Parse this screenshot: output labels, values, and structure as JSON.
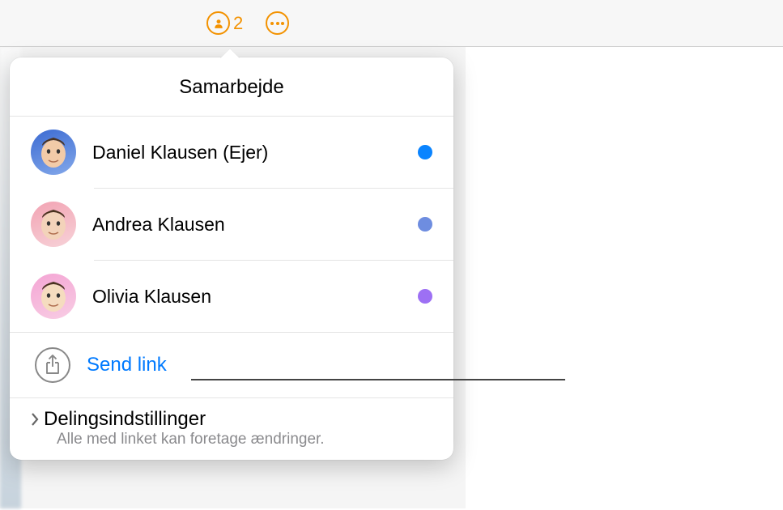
{
  "toolbar": {
    "collab_count": "2"
  },
  "popover": {
    "title": "Samarbejde",
    "participants": [
      {
        "name": "Daniel Klausen (Ejer)",
        "status_color": "#0a84ff",
        "avatar_bg": "linear-gradient(160deg,#3c6bd2,#83a8ea)",
        "face": "#f2cba8"
      },
      {
        "name": "Andrea Klausen",
        "status_color": "#6e8de0",
        "avatar_bg": "linear-gradient(160deg,#f2a3b3,#f7d2d8)",
        "face": "#f3d3ba"
      },
      {
        "name": "Olivia Klausen",
        "status_color": "#9d70f4",
        "avatar_bg": "linear-gradient(160deg,#f4a5d4,#f8cde4)",
        "face": "#f5dcbf"
      }
    ],
    "send_link_label": "Send link",
    "settings": {
      "title": "Delingsindstillinger",
      "subtitle": "Alle med linket kan foretage ændringer."
    }
  }
}
